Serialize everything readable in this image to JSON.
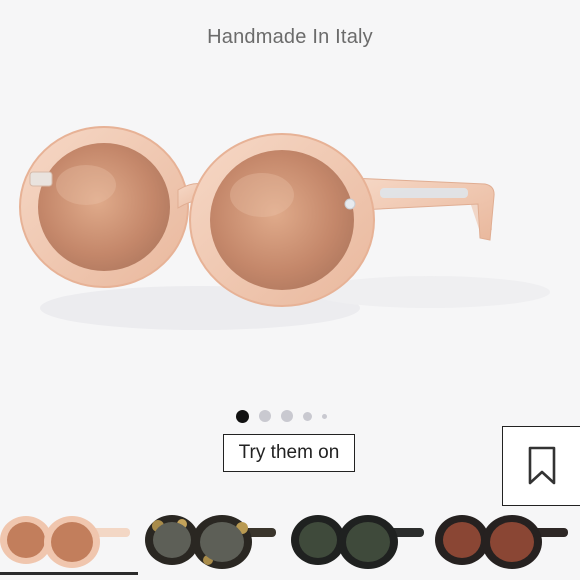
{
  "product": {
    "tagline": "Handmade In Italy",
    "image_alt": "round sunglasses with pink transparent frame and copper mirrored lenses",
    "frame_color": "#f1c9b0",
    "lens_color": "#c98f6c"
  },
  "gallery": {
    "slide_count": 5,
    "active_index": 0
  },
  "actions": {
    "try_on_label": "Try them on",
    "save_icon": "bookmark-icon"
  },
  "color_variants": [
    {
      "name": "pink-transparent-copper",
      "frame": "#f0c6ae",
      "lens": "#c27e5c",
      "selected": true
    },
    {
      "name": "black-tortoise-grey",
      "frame": "#2a2722",
      "lens": "#5d5f57",
      "selected": false
    },
    {
      "name": "black-green",
      "frame": "#1f2120",
      "lens": "#3f4a3b",
      "selected": false
    },
    {
      "name": "black-brown",
      "frame": "#262120",
      "lens": "#8a4634",
      "selected": false
    }
  ]
}
